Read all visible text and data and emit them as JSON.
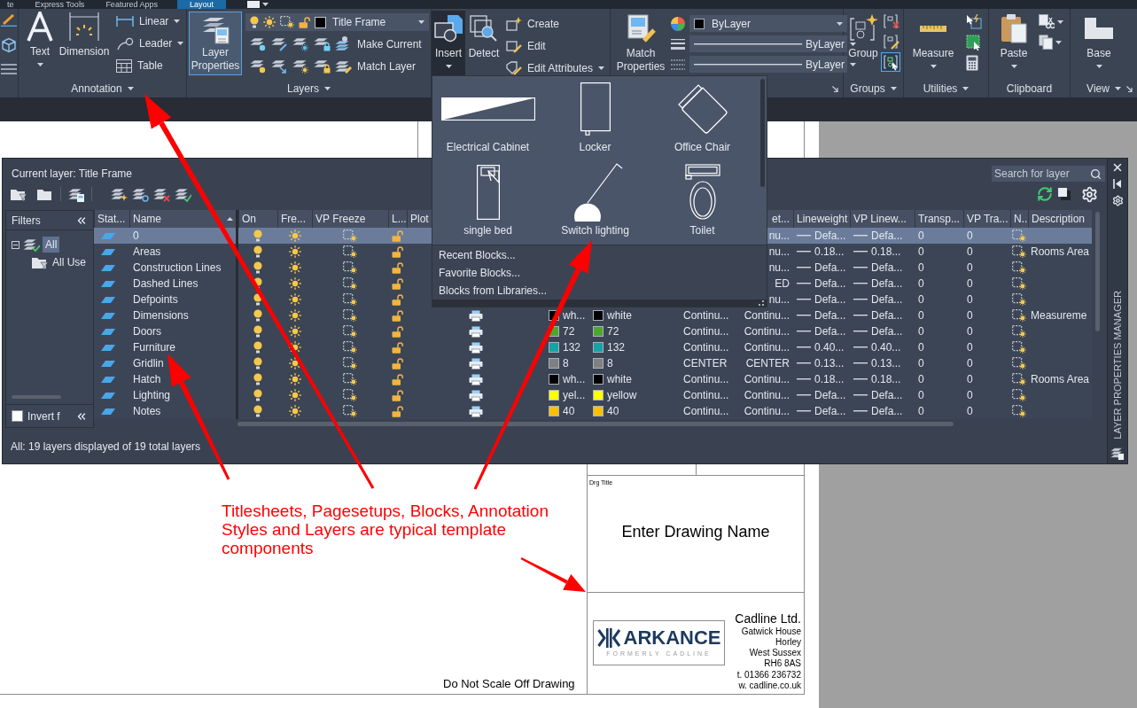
{
  "ribbon_tabs": [
    {
      "label": "te",
      "selected": false
    },
    {
      "label": "Express Tools",
      "selected": false
    },
    {
      "label": "Featured Apps",
      "selected": false
    },
    {
      "label": "Layout",
      "selected": true
    }
  ],
  "ribbon": {
    "annotation": {
      "title": {
        "label": "Annotation",
        "menu": true
      },
      "large": [
        {
          "kind": "text",
          "label": "Text",
          "menu": true
        },
        {
          "kind": "dimension",
          "label": "Dimension",
          "menu": false
        }
      ],
      "small": [
        {
          "kind": "linear",
          "label": "Linear",
          "menu": true
        },
        {
          "kind": "leader",
          "label": "Leader",
          "menu": true
        },
        {
          "kind": "table",
          "label": "Table",
          "menu": false
        }
      ]
    },
    "layers": {
      "title": {
        "label": "Layers",
        "menu": true
      },
      "layer_properties": {
        "label": "Layer Properties",
        "active": true
      },
      "current_layer": {
        "name": "Title Frame",
        "on": true,
        "frozen": false,
        "vp_frozen": false,
        "locked": false
      },
      "actions": [
        {
          "kind": "make-current",
          "label": "Make Current"
        },
        {
          "kind": "match-layer",
          "label": "Match Layer"
        }
      ]
    },
    "block": {
      "insert": {
        "label": "Insert",
        "expanded": true
      },
      "detect": {
        "label": "Detect"
      },
      "tools": [
        {
          "kind": "create",
          "label": "Create",
          "menu": false
        },
        {
          "kind": "edit",
          "label": "Edit",
          "menu": false
        },
        {
          "kind": "edit-attributes",
          "label": "Edit Attributes",
          "menu": true
        }
      ]
    },
    "properties": {
      "match": {
        "label": "Match Properties"
      },
      "dropdowns": [
        {
          "kind": "color",
          "value": "ByLayer"
        },
        {
          "kind": "lineweight",
          "value": "ByLayer"
        },
        {
          "kind": "linetype",
          "value": "ByLayer"
        }
      ]
    },
    "groups": {
      "title": {
        "label": "Groups",
        "menu": true
      },
      "group": {
        "label": "Group"
      },
      "tools": [
        {
          "kind": "ungroup",
          "active": false
        },
        {
          "kind": "group-edit",
          "active": false
        },
        {
          "kind": "group-selection",
          "active": true
        }
      ]
    },
    "utilities": {
      "title": {
        "label": "Utilities",
        "menu": true
      },
      "measure": {
        "label": "Measure",
        "menu": true
      }
    },
    "clipboard": {
      "title": {
        "label": "Clipboard",
        "menu": false
      },
      "paste": {
        "label": "Paste",
        "menu": true
      }
    },
    "view": {
      "title": {
        "label": "View",
        "menu": true
      },
      "base": {
        "label": "Base",
        "menu": true
      }
    }
  },
  "block_gallery": {
    "items": [
      {
        "kind": "cabinet",
        "label": "Electrical Cabinet"
      },
      {
        "kind": "locker",
        "label": "Locker"
      },
      {
        "kind": "chair",
        "label": "Office Chair"
      },
      {
        "kind": "bed",
        "label": "single bed"
      },
      {
        "kind": "switch",
        "label": "Switch lighting"
      },
      {
        "kind": "toilet",
        "label": "Toilet"
      }
    ],
    "menu": [
      "Recent Blocks...",
      "Favorite Blocks...",
      "Blocks from Libraries..."
    ]
  },
  "layer_manager": {
    "side_title": "LAYER PROPERTIES MANAGER",
    "current_layer": "Current layer: Title Frame",
    "search": {
      "placeholder": "Search for layer"
    },
    "filters": {
      "title": "Filters",
      "tree": [
        {
          "label": "All",
          "selected": true,
          "expanded": true,
          "children": [
            {
              "label": "All Use",
              "selected": false
            }
          ]
        }
      ],
      "invert": {
        "label": "Invert f",
        "checked": false
      }
    },
    "columns": [
      {
        "kind": "status",
        "label": "Stat...",
        "sorted": false
      },
      {
        "kind": "name",
        "label": "Name",
        "sorted": true
      },
      {
        "kind": "on",
        "label": "On",
        "sorted": false
      },
      {
        "kind": "freeze",
        "label": "Fre...",
        "sorted": false
      },
      {
        "kind": "vp_freeze",
        "label": "VP Freeze",
        "sorted": false
      },
      {
        "kind": "lock",
        "label": "L...",
        "sorted": false
      },
      {
        "kind": "plot",
        "label": "Plot"
      },
      {
        "kind": "column_11",
        "label": "et...",
        "sorted": false
      },
      {
        "kind": "lineweight",
        "label": "Lineweight",
        "sorted": false
      },
      {
        "kind": "vp_lineweight",
        "label": "VP Linew...",
        "sorted": false
      },
      {
        "kind": "transparency",
        "label": "Transp...",
        "sorted": false
      },
      {
        "kind": "vp_transparency",
        "label": "VP Tra...",
        "sorted": false
      },
      {
        "kind": "new_vp_freeze",
        "label": "N..",
        "sorted": false
      },
      {
        "kind": "description",
        "label": "Description",
        "sorted": false
      }
    ],
    "rows": [
      {
        "name": "0",
        "selected": true,
        "on": true,
        "frozen": false,
        "vp_frozen": false,
        "locked": false,
        "column_11": "nu...",
        "lineweight": "Defa...",
        "vp_lineweight": "Defa...",
        "transparency": "0",
        "vp_transparency": "0",
        "new_vp_frozen": false
      },
      {
        "name": "Areas",
        "selected": false,
        "on": true,
        "frozen": false,
        "vp_frozen": false,
        "locked": false,
        "column_11": "nu...",
        "lineweight": "0.18...",
        "vp_lineweight": "0.18...",
        "transparency": "0",
        "vp_transparency": "0",
        "new_vp_frozen": false,
        "description": "Rooms Area"
      },
      {
        "name": "Construction Lines",
        "selected": false,
        "on": true,
        "frozen": false,
        "vp_frozen": false,
        "locked": false,
        "column_11": "nu...",
        "lineweight": "Defa...",
        "vp_lineweight": "Defa...",
        "transparency": "0",
        "vp_transparency": "0",
        "new_vp_frozen": false
      },
      {
        "name": "Dashed Lines",
        "selected": false,
        "on": true,
        "frozen": false,
        "vp_frozen": false,
        "locked": false,
        "column_11": "ED",
        "lineweight": "Defa...",
        "vp_lineweight": "Defa...",
        "transparency": "0",
        "vp_transparency": "0",
        "new_vp_frozen": false
      },
      {
        "name": "Defpoints",
        "selected": false,
        "on": true,
        "frozen": false,
        "vp_frozen": false,
        "locked": false,
        "column_11": "nu...",
        "lineweight": "Defa...",
        "vp_lineweight": "Defa...",
        "transparency": "0",
        "vp_transparency": "0",
        "new_vp_frozen": false
      },
      {
        "name": "Dimensions",
        "selected": false,
        "on": true,
        "frozen": false,
        "vp_frozen": false,
        "locked": false,
        "plot": true,
        "column_8": {
          "label": "wh...",
          "color": "#000000"
        },
        "column_9": {
          "label": "white",
          "color": "#000000"
        },
        "column_10": "Continu...",
        "column_11": "Continu...",
        "lineweight": "Defa...",
        "vp_lineweight": "Defa...",
        "transparency": "0",
        "vp_transparency": "0",
        "new_vp_frozen": false,
        "description": "Measureme"
      },
      {
        "name": "Doors",
        "selected": false,
        "on": true,
        "frozen": false,
        "vp_frozen": false,
        "locked": false,
        "plot": true,
        "column_8": {
          "label": "72",
          "color": "#4ca82c"
        },
        "column_9": {
          "label": "72",
          "color": "#4ca82c"
        },
        "column_10": "Continu...",
        "column_11": "Continu...",
        "lineweight": "Defa...",
        "vp_lineweight": "Defa...",
        "transparency": "0",
        "vp_transparency": "0",
        "new_vp_frozen": false
      },
      {
        "name": "Furniture",
        "selected": false,
        "on": true,
        "frozen": false,
        "vp_frozen": false,
        "locked": false,
        "plot": true,
        "column_8": {
          "label": "132",
          "color": "#14a3a6"
        },
        "column_9": {
          "label": "132",
          "color": "#14a3a6"
        },
        "column_10": "Continu...",
        "column_11": "Continu...",
        "lineweight": "0.40...",
        "vp_lineweight": "0.40...",
        "transparency": "0",
        "vp_transparency": "0",
        "new_vp_frozen": false
      },
      {
        "name": "Gridlin",
        "selected": false,
        "on": true,
        "frozen": false,
        "vp_frozen": false,
        "locked": false,
        "plot": true,
        "column_8": {
          "label": "8",
          "color": "#808080"
        },
        "column_9": {
          "label": "8",
          "color": "#808080"
        },
        "column_10": "CENTER",
        "column_11": "CENTER",
        "lineweight": "0.13...",
        "vp_lineweight": "0.13...",
        "transparency": "0",
        "vp_transparency": "0",
        "new_vp_frozen": false
      },
      {
        "name": "Hatch",
        "selected": false,
        "on": true,
        "frozen": false,
        "vp_frozen": false,
        "locked": false,
        "plot": true,
        "column_8": {
          "label": "wh...",
          "color": "#000000"
        },
        "column_9": {
          "label": "white",
          "color": "#000000"
        },
        "column_10": "Continu...",
        "column_11": "Continu...",
        "lineweight": "0.18...",
        "vp_lineweight": "0.18...",
        "transparency": "0",
        "vp_transparency": "0",
        "new_vp_frozen": false,
        "description": "Rooms Area"
      },
      {
        "name": "Lighting",
        "selected": false,
        "on": true,
        "frozen": false,
        "vp_frozen": false,
        "locked": false,
        "plot": true,
        "column_8": {
          "label": "yel...",
          "color": "#ffff00"
        },
        "column_9": {
          "label": "yellow",
          "color": "#ffff00"
        },
        "column_10": "Continu...",
        "column_11": "Continu...",
        "lineweight": "Defa...",
        "vp_lineweight": "Defa...",
        "transparency": "0",
        "vp_transparency": "0",
        "new_vp_frozen": false
      },
      {
        "name": "Notes",
        "selected": false,
        "on": true,
        "frozen": false,
        "vp_frozen": false,
        "locked": false,
        "plot": true,
        "column_8": {
          "label": "40",
          "color": "#ffbf00"
        },
        "column_9": {
          "label": "40",
          "color": "#ffbf00"
        },
        "column_10": "Continu...",
        "column_11": "Continu...",
        "lineweight": "Defa...",
        "vp_lineweight": "Defa...",
        "transparency": "0",
        "vp_transparency": "0",
        "new_vp_frozen": false
      }
    ],
    "status": "All: 19 layers displayed of 19 total layers"
  },
  "drawing": {
    "title_block": {
      "caption": "Drg Title",
      "drawing_name": "Enter Drawing Name",
      "logo": {
        "name": "ARKANCE",
        "tagline": "FORMERLY CADLINE"
      },
      "company": "Cadline Ltd.",
      "address": [
        "Gatwick House",
        "Horley",
        "West Sussex",
        "RH6 8AS",
        "t. 01366 236732",
        "w. cadline.co.uk"
      ]
    },
    "note": "Do Not Scale Off Drawing"
  },
  "callout": "Titlesheets, Pagesetups, Blocks, Annotation Styles and Layers are typical template components"
}
